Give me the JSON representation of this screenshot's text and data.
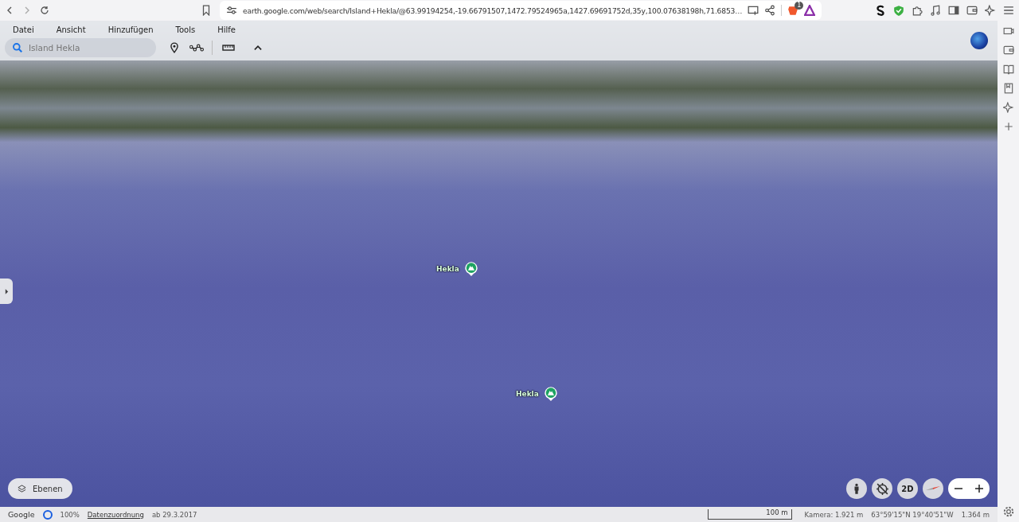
{
  "browser": {
    "url": "earth.google.com/web/search/Island+Hekla/@63.99194254,-19.66791507,1472.79524965a,1427.69691752d,35y,100.07638198h,71.6853…",
    "extension_badge": "1"
  },
  "menu": [
    "Datei",
    "Ansicht",
    "Hinzufügen",
    "Tools",
    "Hilfe"
  ],
  "search": {
    "placeholder": "Island Hekla"
  },
  "places": [
    {
      "label": "Hekla"
    },
    {
      "label": "Hekla"
    }
  ],
  "layers_button": "Ebenen",
  "view_toggle": "2D",
  "status_bar": {
    "brand": "Google",
    "progress": "100%",
    "attribution": "Datenzuordnung",
    "imagery_date": "ab 29.3.2017",
    "scale": "100 m",
    "camera": "Kamera: 1.921 m",
    "coordinates": "63°59'15\"N 19°40'51\"W",
    "elevation": "1.364 m"
  }
}
